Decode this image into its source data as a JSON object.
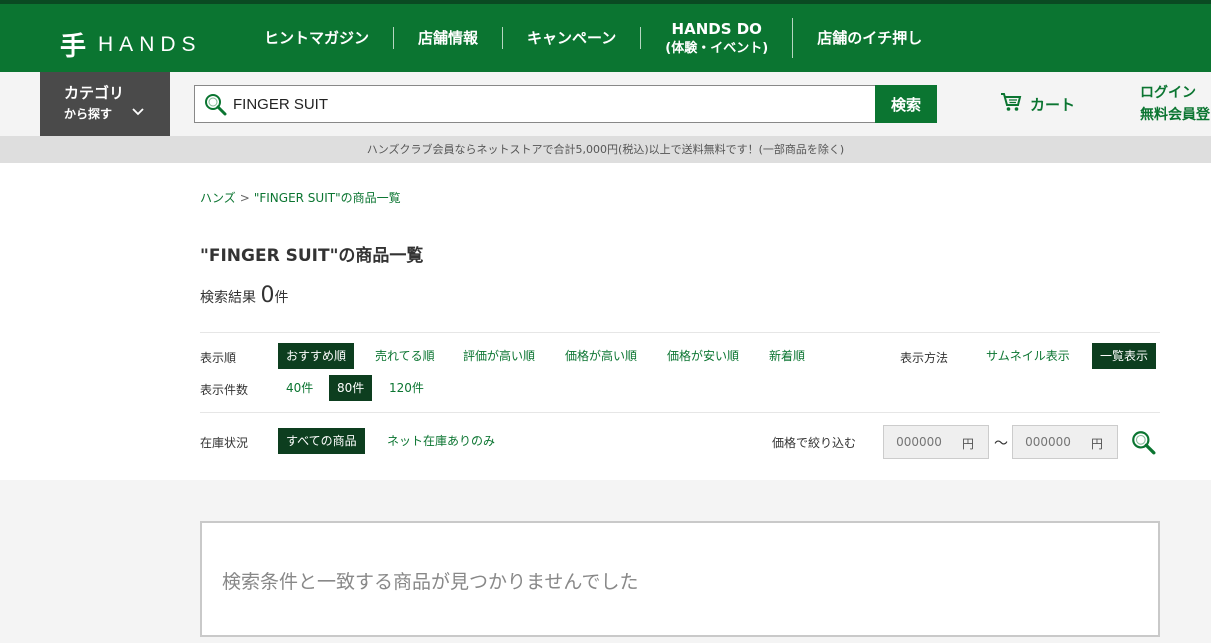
{
  "header": {
    "logo_mark": "手",
    "logo_text": "HANDS",
    "nav": [
      {
        "label": "ヒントマガジン"
      },
      {
        "label": "店舗情報"
      },
      {
        "label": "キャンペーン"
      },
      {
        "label": "HANDS DO",
        "sub": "(体験・イベント)"
      },
      {
        "label": "店舗のイチ押し"
      }
    ]
  },
  "search": {
    "category_line1": "カテゴリ",
    "category_line2": "から探す",
    "query": "FINGER SUIT",
    "button": "検索",
    "cart": "カート",
    "login": "ログイン",
    "register": "無料会員登"
  },
  "notice": "ハンズクラブ会員ならネットストアで合計5,000円(税込)以上で送料無料です！(一部商品を除く)",
  "breadcrumb": {
    "home": "ハンズ",
    "sep": ">",
    "current": "\"FINGER SUIT\"の商品一覧"
  },
  "page_title": "\"FINGER SUIT\"の商品一覧",
  "result": {
    "label": "検索結果",
    "count": "0",
    "unit": "件"
  },
  "sort": {
    "label": "表示順",
    "options": [
      "おすすめ順",
      "売れてる順",
      "評価が高い順",
      "価格が高い順",
      "価格が安い順",
      "新着順"
    ]
  },
  "display": {
    "label": "表示方法",
    "options": [
      "サムネイル表示",
      "一覧表示"
    ]
  },
  "per_page": {
    "label": "表示件数",
    "options": [
      "40件",
      "80件",
      "120件"
    ]
  },
  "stock": {
    "label": "在庫状況",
    "options": [
      "すべての商品",
      "ネット在庫ありのみ"
    ]
  },
  "price_filter": {
    "label": "価格で絞り込む",
    "min_placeholder": "000000",
    "max_placeholder": "000000",
    "yen": "円",
    "tilde": "〜"
  },
  "empty_message": "検索条件と一致する商品が見つかりませんでした",
  "colors": {
    "brand": "#0b7531",
    "active": "#0d3e1f"
  }
}
